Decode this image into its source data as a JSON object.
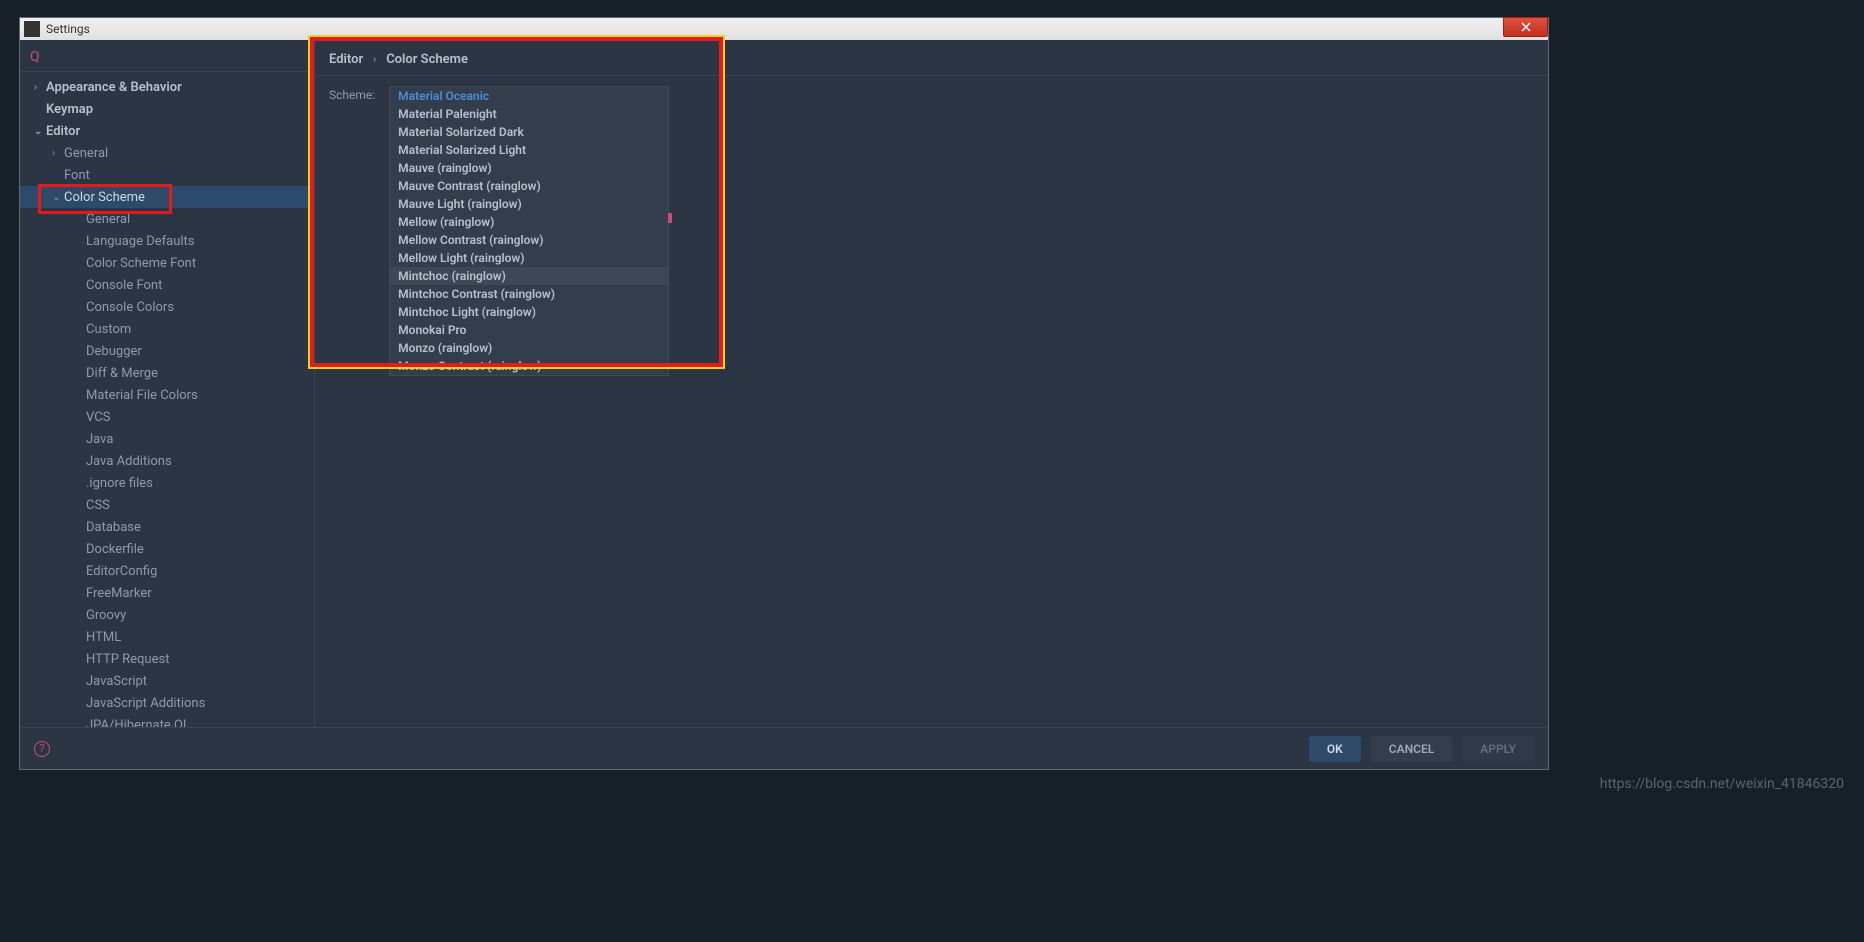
{
  "titlebar": {
    "title": "Settings"
  },
  "sidebar": {
    "items": [
      {
        "label": "Appearance & Behavior",
        "bold": true,
        "level": 1,
        "arrow": ">"
      },
      {
        "label": "Keymap",
        "bold": true,
        "level": 1,
        "arrow": ""
      },
      {
        "label": "Editor",
        "bold": true,
        "level": 1,
        "arrow": "v"
      },
      {
        "label": "General",
        "bold": false,
        "level": 2,
        "arrow": ">"
      },
      {
        "label": "Font",
        "bold": false,
        "level": 2,
        "arrow": ""
      },
      {
        "label": "Color Scheme",
        "bold": false,
        "level": 2,
        "arrow": "v",
        "selected": true
      },
      {
        "label": "General",
        "bold": false,
        "level": 3,
        "arrow": ""
      },
      {
        "label": "Language Defaults",
        "bold": false,
        "level": 3,
        "arrow": ""
      },
      {
        "label": "Color Scheme Font",
        "bold": false,
        "level": 3,
        "arrow": ""
      },
      {
        "label": "Console Font",
        "bold": false,
        "level": 3,
        "arrow": ""
      },
      {
        "label": "Console Colors",
        "bold": false,
        "level": 3,
        "arrow": ""
      },
      {
        "label": "Custom",
        "bold": false,
        "level": 3,
        "arrow": ""
      },
      {
        "label": "Debugger",
        "bold": false,
        "level": 3,
        "arrow": ""
      },
      {
        "label": "Diff & Merge",
        "bold": false,
        "level": 3,
        "arrow": ""
      },
      {
        "label": "Material File Colors",
        "bold": false,
        "level": 3,
        "arrow": ""
      },
      {
        "label": "VCS",
        "bold": false,
        "level": 3,
        "arrow": ""
      },
      {
        "label": "Java",
        "bold": false,
        "level": 3,
        "arrow": ""
      },
      {
        "label": "Java Additions",
        "bold": false,
        "level": 3,
        "arrow": ""
      },
      {
        "label": ".ignore files",
        "bold": false,
        "level": 3,
        "arrow": ""
      },
      {
        "label": "CSS",
        "bold": false,
        "level": 3,
        "arrow": ""
      },
      {
        "label": "Database",
        "bold": false,
        "level": 3,
        "arrow": ""
      },
      {
        "label": "Dockerfile",
        "bold": false,
        "level": 3,
        "arrow": ""
      },
      {
        "label": "EditorConfig",
        "bold": false,
        "level": 3,
        "arrow": ""
      },
      {
        "label": "FreeMarker",
        "bold": false,
        "level": 3,
        "arrow": ""
      },
      {
        "label": "Groovy",
        "bold": false,
        "level": 3,
        "arrow": ""
      },
      {
        "label": "HTML",
        "bold": false,
        "level": 3,
        "arrow": ""
      },
      {
        "label": "HTTP Request",
        "bold": false,
        "level": 3,
        "arrow": ""
      },
      {
        "label": "JavaScript",
        "bold": false,
        "level": 3,
        "arrow": ""
      },
      {
        "label": "JavaScript Additions",
        "bold": false,
        "level": 3,
        "arrow": ""
      },
      {
        "label": "JPA/Hibernate QL",
        "bold": false,
        "level": 3,
        "arrow": ""
      }
    ]
  },
  "breadcrumb": {
    "part1": "Editor",
    "part2": "Color Scheme"
  },
  "scheme": {
    "label": "Scheme:",
    "options": [
      {
        "label": "Material Oceanic",
        "accent": true
      },
      {
        "label": "Material Palenight"
      },
      {
        "label": "Material Solarized Dark"
      },
      {
        "label": "Material Solarized Light"
      },
      {
        "label": "Mauve (rainglow)"
      },
      {
        "label": "Mauve Contrast (rainglow)"
      },
      {
        "label": "Mauve Light (rainglow)"
      },
      {
        "label": "Mellow (rainglow)"
      },
      {
        "label": "Mellow Contrast (rainglow)"
      },
      {
        "label": "Mellow Light (rainglow)"
      },
      {
        "label": "Mintchoc (rainglow)",
        "hover": true
      },
      {
        "label": "Mintchoc Contrast (rainglow)"
      },
      {
        "label": "Mintchoc Light (rainglow)"
      },
      {
        "label": "Monokai Pro"
      },
      {
        "label": "Monzo (rainglow)"
      },
      {
        "label": "Monzo Contrast (rainglow)"
      }
    ]
  },
  "footer": {
    "ok": "OK",
    "cancel": "CANCEL",
    "apply": "APPLY"
  },
  "watermark": "https://blog.csdn.net/weixin_41846320"
}
